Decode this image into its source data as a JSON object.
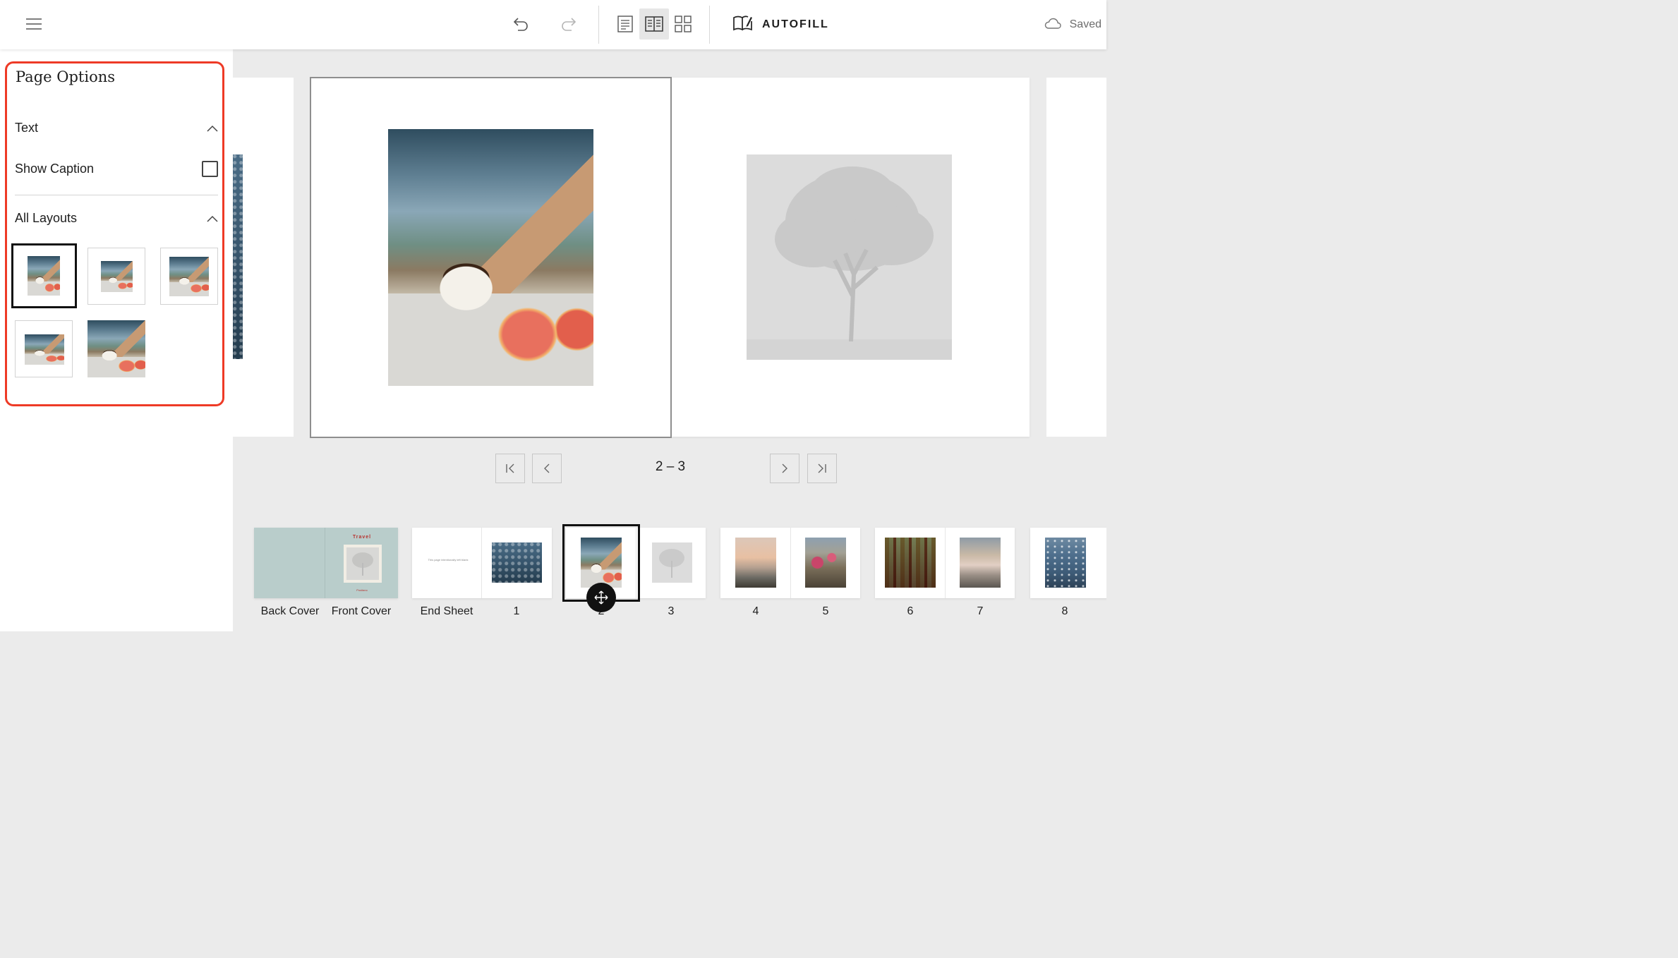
{
  "toolbar": {
    "menu_icon": "hamburger-menu-icon",
    "undo_icon": "undo-icon",
    "redo_icon": "redo-icon",
    "view_icons": [
      "single-page-view-icon",
      "spread-view-icon",
      "grid-view-icon"
    ],
    "autofill_icon": "book-pencil-icon",
    "autofill_label": "AUTOFILL",
    "saved_icon": "cloud-icon",
    "saved_label": "Saved"
  },
  "panel": {
    "title": "Page Options",
    "text_section": "Text",
    "show_caption_label": "Show Caption",
    "show_caption_checked": false,
    "layouts_section": "All Layouts",
    "layouts_count": 5,
    "selected_layout": 1
  },
  "spread": {
    "page_indicator": "2 – 3"
  },
  "filmstrip": {
    "cover_title": "Travel",
    "cover_sub": "Positano",
    "endsheet_text": "This page intentionally left blank",
    "labels": {
      "back_cover": "Back Cover",
      "front_cover": "Front Cover",
      "end_sheet": "End Sheet",
      "p1": "1",
      "p2": "2",
      "p3": "3",
      "p4": "4",
      "p5": "5",
      "p6": "6",
      "p7": "7",
      "p8": "8"
    }
  },
  "colors": {
    "accent_outline": "#ee3a26",
    "cover_teal": "#b9cdcb",
    "cover_title_red": "#b8322e"
  }
}
